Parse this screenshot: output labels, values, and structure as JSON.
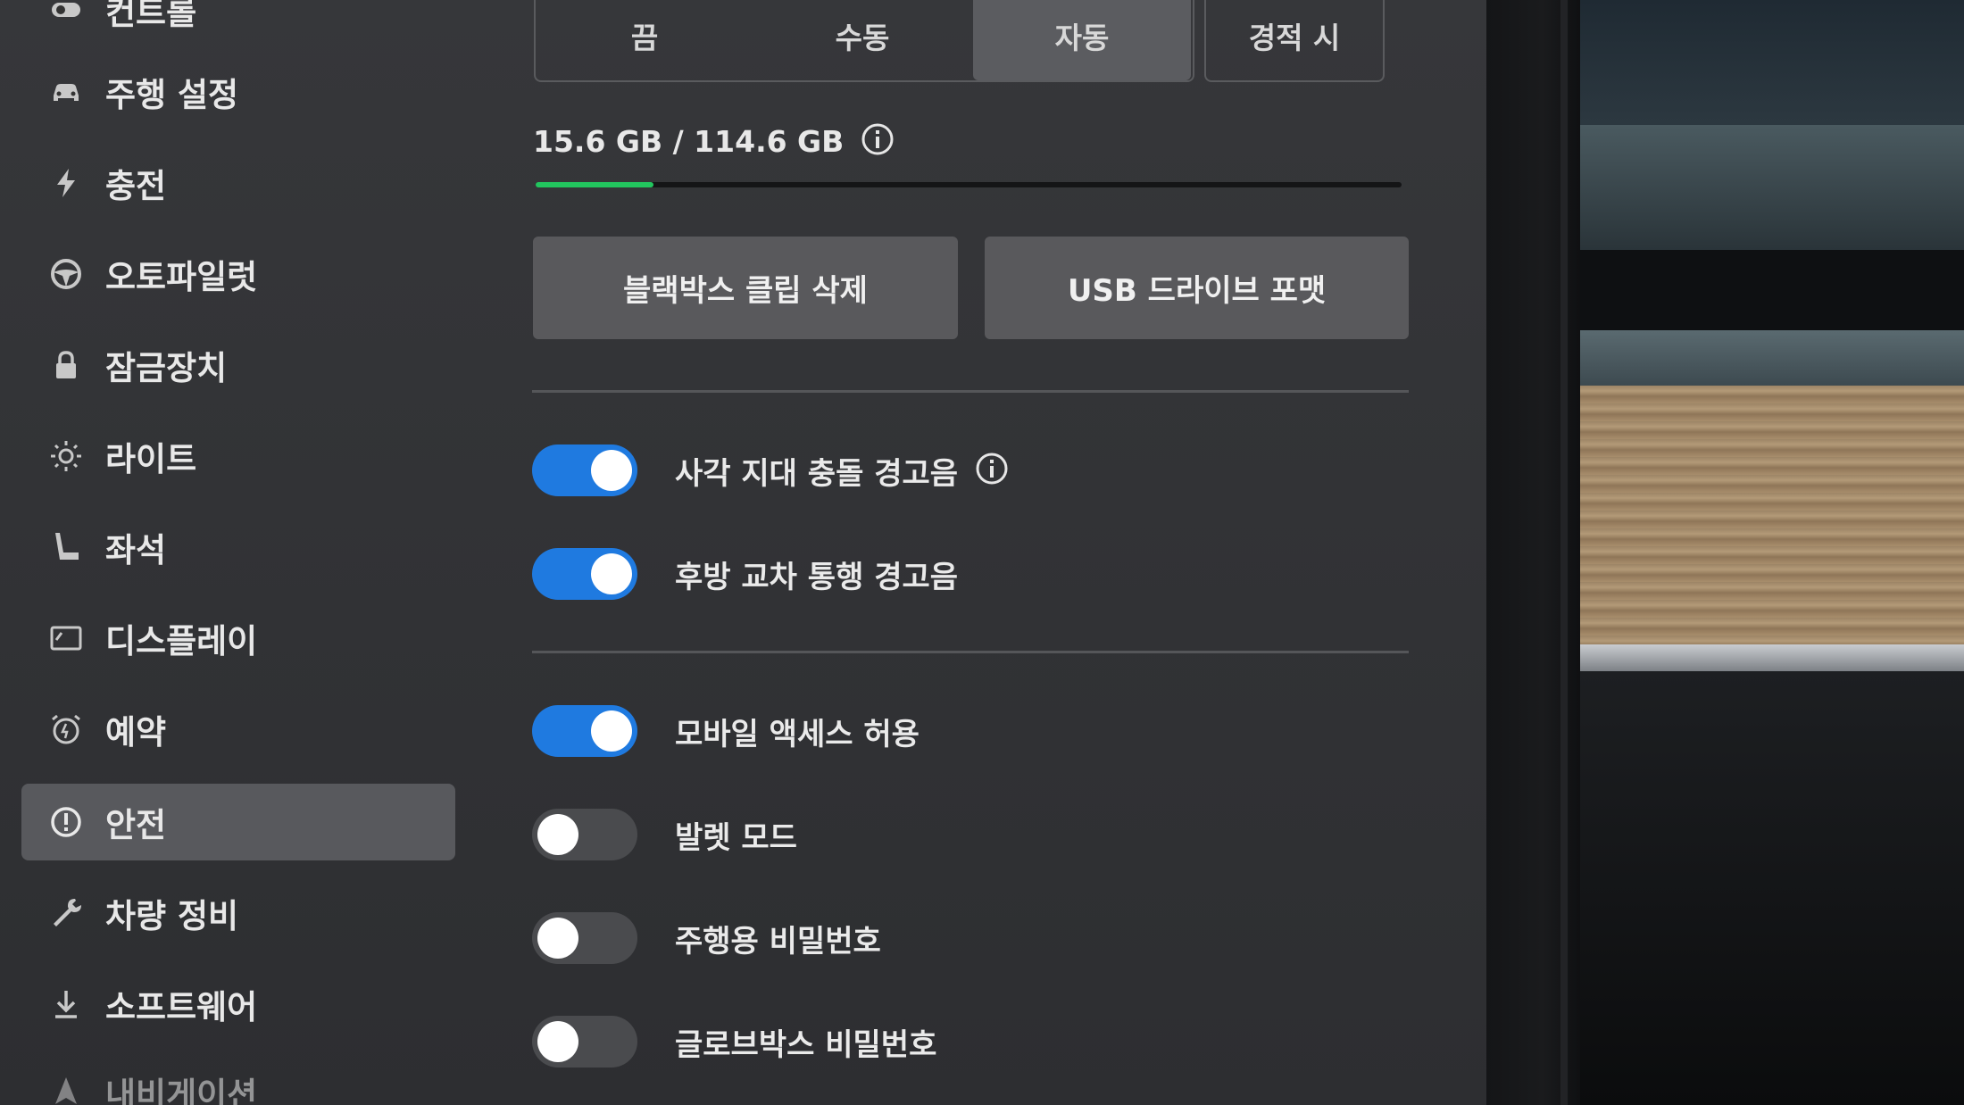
{
  "sidebar": {
    "items": [
      {
        "label": "컨트롤",
        "icon": "toggle-icon"
      },
      {
        "label": "주행 설정",
        "icon": "car-icon"
      },
      {
        "label": "충전",
        "icon": "lightning-icon"
      },
      {
        "label": "오토파일럿",
        "icon": "steering-wheel-icon"
      },
      {
        "label": "잠금장치",
        "icon": "lock-icon"
      },
      {
        "label": "라이트",
        "icon": "sun-icon"
      },
      {
        "label": "좌석",
        "icon": "seat-icon"
      },
      {
        "label": "디스플레이",
        "icon": "display-icon"
      },
      {
        "label": "예약",
        "icon": "alarm-clock-icon"
      },
      {
        "label": "안전",
        "icon": "alert-circle-icon",
        "active": true
      },
      {
        "label": "차량 정비",
        "icon": "wrench-icon"
      },
      {
        "label": "소프트웨어",
        "icon": "download-icon"
      },
      {
        "label": "내비게이션",
        "icon": "navigation-icon"
      }
    ]
  },
  "dashcam_mode": {
    "options": [
      "끔",
      "수동",
      "자동"
    ],
    "selected": "자동",
    "extra_option": "경적 시"
  },
  "storage": {
    "text": "15.6 GB / 114.6 GB",
    "used_fraction": 0.136
  },
  "actions": {
    "delete_clips": "블랙박스 클립 삭제",
    "format_usb": "USB 드라이브 포맷"
  },
  "toggles": [
    {
      "label": "사각 지대 충돌 경고음",
      "on": true,
      "has_info": true
    },
    {
      "label": "후방 교차 통행 경고음",
      "on": true,
      "has_info": false
    },
    {
      "label": "모바일 액세스 허용",
      "on": true,
      "has_info": false
    },
    {
      "label": "발렛 모드",
      "on": false,
      "has_info": false
    },
    {
      "label": "주행용 비밀번호",
      "on": false,
      "has_info": false
    },
    {
      "label": "글로브박스 비밀번호",
      "on": false,
      "has_info": false
    }
  ],
  "colors": {
    "accent": "#1f7ae0",
    "progress": "#22c55e",
    "panel": "#333437"
  }
}
